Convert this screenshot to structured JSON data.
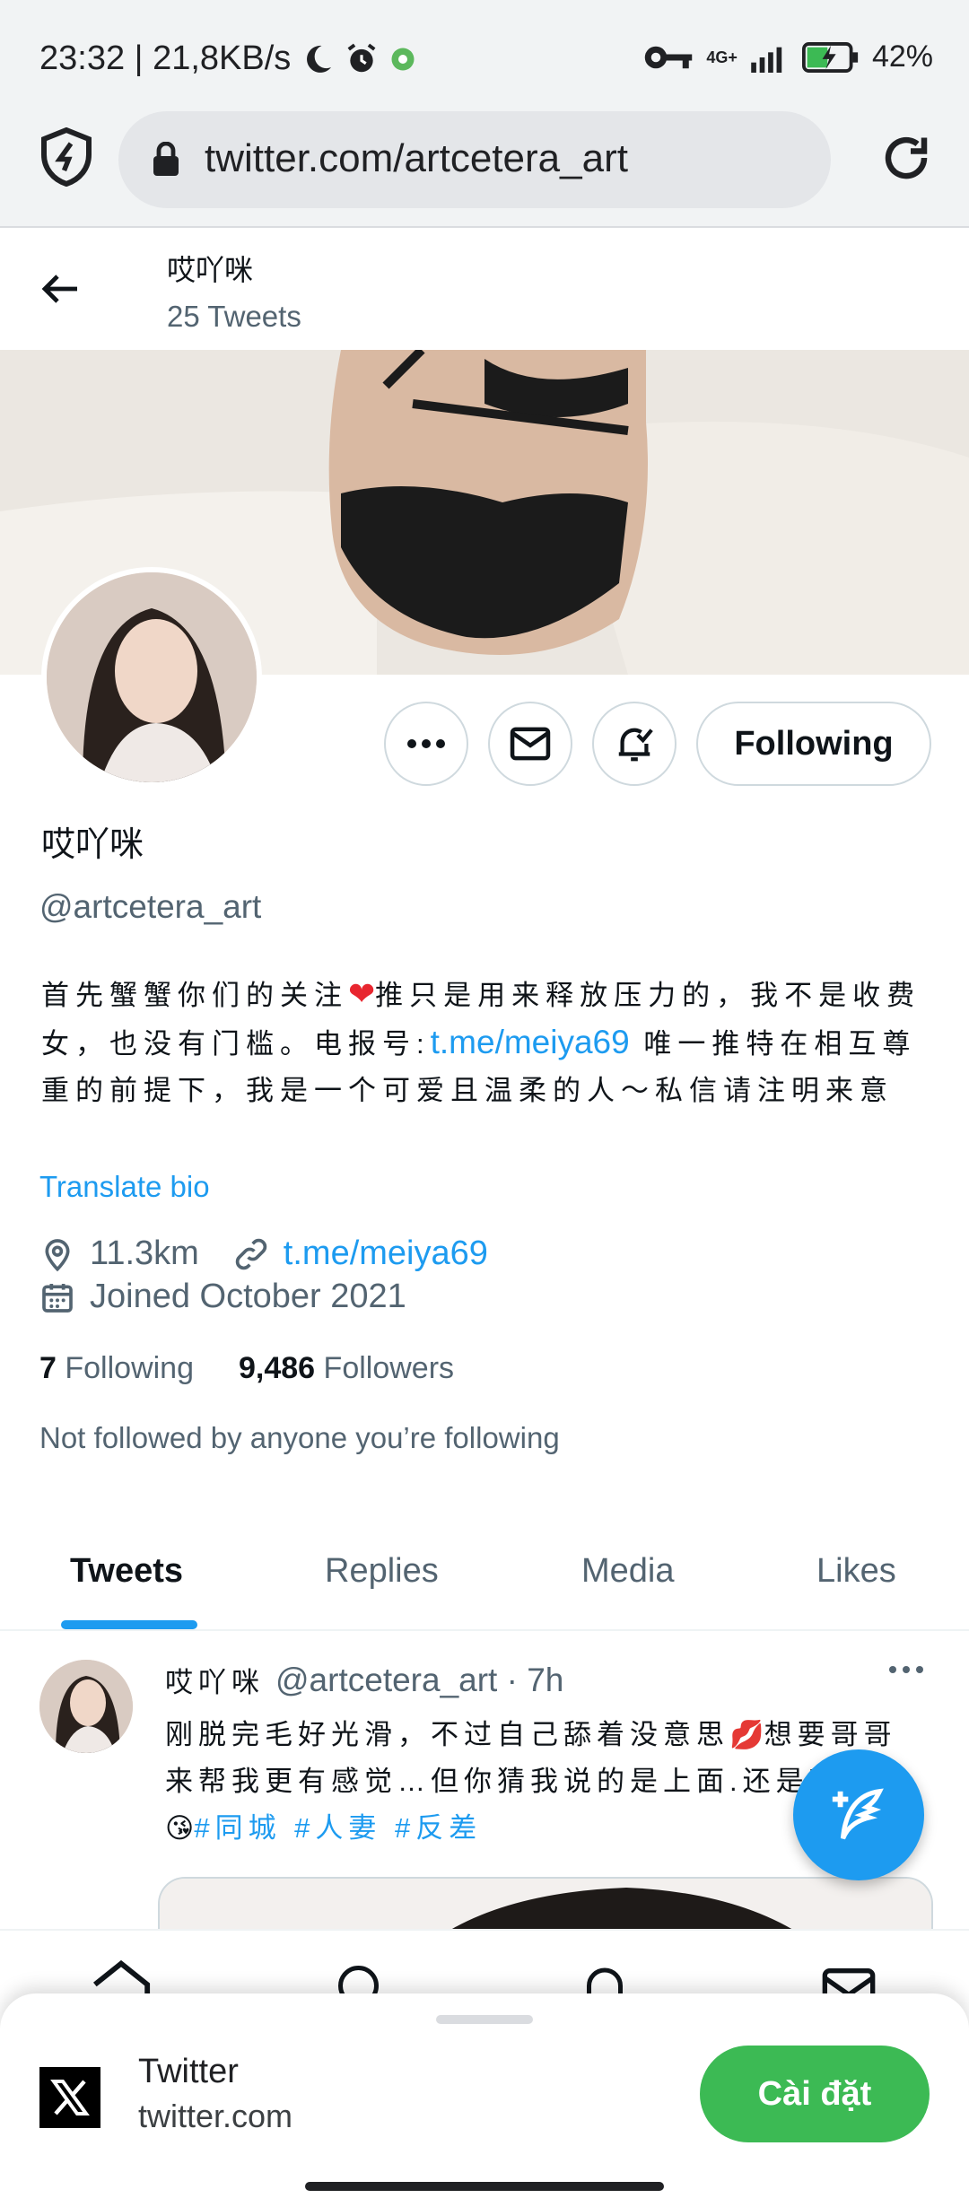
{
  "status_bar": {
    "time_speed": "23:32 | 21,8KB/s",
    "network": "4G+",
    "battery": "42%"
  },
  "browser": {
    "url": "twitter.com/artcetera_art"
  },
  "header": {
    "name": "哎吖咪",
    "tweet_count": "25 Tweets"
  },
  "profile": {
    "display_name": "哎吖咪",
    "handle": "@artcetera_art",
    "follow_button": "Following",
    "bio_part1": "首先蟹蟹你们的关注",
    "bio_part2": "推只是用来释放压力的，我不是收费女，也没有门槛。电报号:",
    "bio_link": "t.me/meiya69",
    "bio_part3": " 唯一推特在相互尊重的前提下，我是一个可爱且温柔的人～私信请注明来意",
    "translate": "Translate bio",
    "location": "11.3km",
    "website": "t.me/meiya69",
    "joined": "Joined October 2021",
    "following_count": "7",
    "following_label": "Following",
    "followers_count": "9,486",
    "followers_label": "Followers",
    "not_followed": "Not followed by anyone you’re following"
  },
  "tabs": [
    {
      "label": "Tweets"
    },
    {
      "label": "Replies"
    },
    {
      "label": "Media"
    },
    {
      "label": "Likes"
    }
  ],
  "tweet": {
    "name": "哎吖咪",
    "handle_time": "@artcetera_art · 7h",
    "text1": "刚脱完毛好光滑，不过自己舔着没意思",
    "text2": "想要哥哥来帮我更有感觉…但你猜我说的是上面.还是下面",
    "tags": "#同城 #人妻 #反差"
  },
  "install_banner": {
    "app_name": "Twitter",
    "domain": "twitter.com",
    "install_label": "Cài đặt"
  },
  "colors": {
    "accent": "#1d9bf0",
    "install": "#3cba54"
  }
}
